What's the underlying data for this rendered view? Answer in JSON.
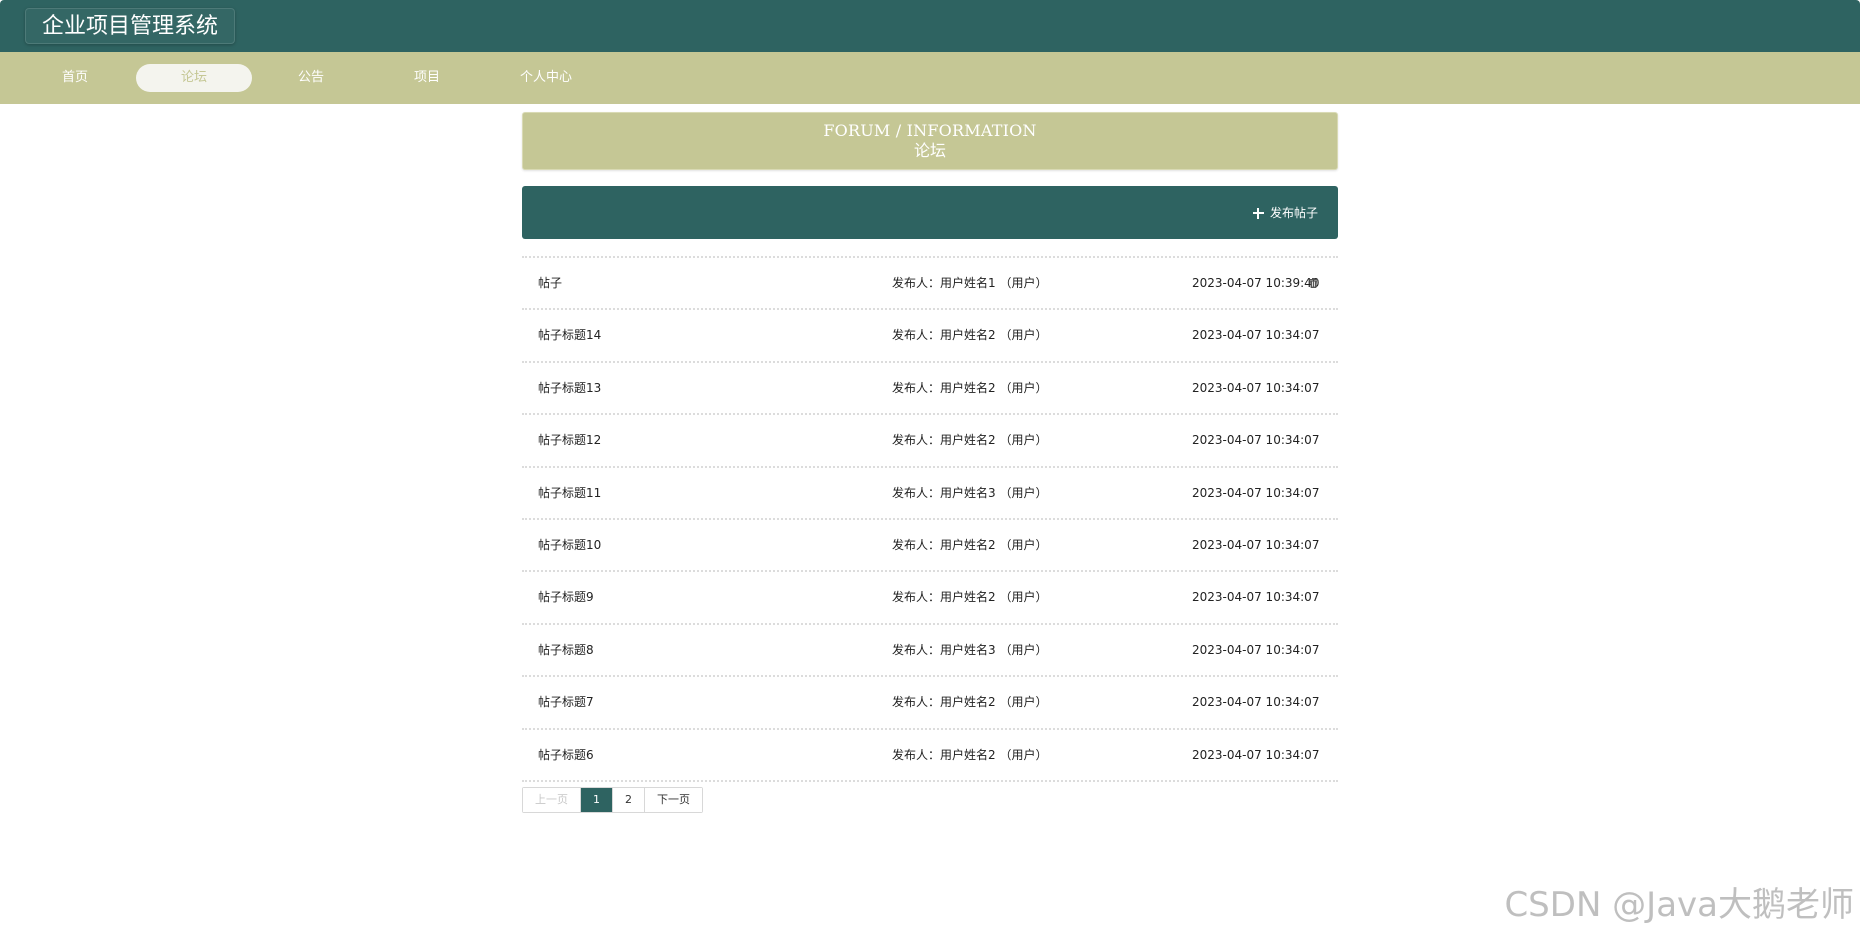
{
  "header": {
    "site_title": "企业项目管理系统"
  },
  "nav": {
    "items": [
      {
        "label": "首页",
        "active": false
      },
      {
        "label": "论坛",
        "active": true
      },
      {
        "label": "公告",
        "active": false
      },
      {
        "label": "项目",
        "active": false
      },
      {
        "label": "个人中心",
        "active": false
      }
    ]
  },
  "banner": {
    "title_en": "FORUM / INFORMATION",
    "title_cn": "论坛"
  },
  "toolbar": {
    "post_button_label": "发布帖子",
    "post_button_icon": "plus-icon"
  },
  "posts": [
    {
      "title": "帖子",
      "author": "发布人：用户姓名1 （用户）",
      "time": "2023-04-07 10:39:40",
      "deletable": true
    },
    {
      "title": "帖子标题14",
      "author": "发布人：用户姓名2 （用户）",
      "time": "2023-04-07 10:34:07",
      "deletable": false
    },
    {
      "title": "帖子标题13",
      "author": "发布人：用户姓名2 （用户）",
      "time": "2023-04-07 10:34:07",
      "deletable": false
    },
    {
      "title": "帖子标题12",
      "author": "发布人：用户姓名2 （用户）",
      "time": "2023-04-07 10:34:07",
      "deletable": false
    },
    {
      "title": "帖子标题11",
      "author": "发布人：用户姓名3 （用户）",
      "time": "2023-04-07 10:34:07",
      "deletable": false
    },
    {
      "title": "帖子标题10",
      "author": "发布人：用户姓名2 （用户）",
      "time": "2023-04-07 10:34:07",
      "deletable": false
    },
    {
      "title": "帖子标题9",
      "author": "发布人：用户姓名2 （用户）",
      "time": "2023-04-07 10:34:07",
      "deletable": false
    },
    {
      "title": "帖子标题8",
      "author": "发布人：用户姓名3 （用户）",
      "time": "2023-04-07 10:34:07",
      "deletable": false
    },
    {
      "title": "帖子标题7",
      "author": "发布人：用户姓名2 （用户）",
      "time": "2023-04-07 10:34:07",
      "deletable": false
    },
    {
      "title": "帖子标题6",
      "author": "发布人：用户姓名2 （用户）",
      "time": "2023-04-07 10:34:07",
      "deletable": false
    }
  ],
  "pagination": {
    "prev_label": "上一页",
    "pages": [
      "1",
      "2"
    ],
    "current_page": "1",
    "next_label": "下一页"
  },
  "watermark": "CSDN @Java大鹅老师",
  "colors": {
    "primary": "#2e6361",
    "accent": "#c5c795",
    "background": "#ffffff"
  }
}
